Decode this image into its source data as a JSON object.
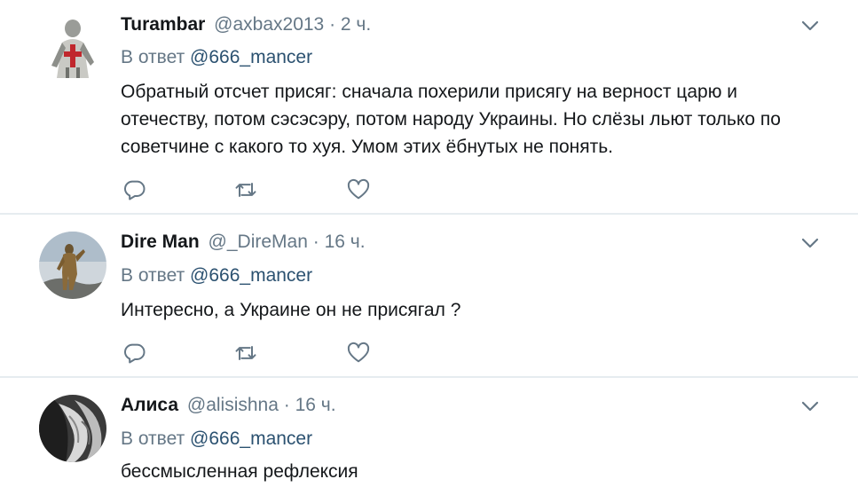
{
  "tweets": [
    {
      "name": "Turambar",
      "handle": "@axbax2013",
      "separator": "·",
      "time": "2 ч.",
      "reply_prefix": "В ответ",
      "reply_to": "@666_mancer",
      "text": "Обратный отсчет присяг: сначала похерили присягу на верност царю и отечеству, потом сэсэсэру, потом народу Украины. Но слёзы льют только по советчине с какого то хуя. Умом этих ёбнутых не понять."
    },
    {
      "name": "Dire Man",
      "handle": "@_DireMan",
      "separator": "·",
      "time": "16 ч.",
      "reply_prefix": "В ответ",
      "reply_to": "@666_mancer",
      "text": "Интересно, а Украине он не присягал ?"
    },
    {
      "name": "Алиса",
      "handle": "@alisishna",
      "separator": "·",
      "time": "16 ч.",
      "reply_prefix": "В ответ",
      "reply_to": "@666_mancer",
      "text": "бессмысленная рефлексия"
    }
  ],
  "icons": {
    "reply": "reply-icon",
    "retweet": "retweet-icon",
    "like": "heart-icon",
    "menu": "chevron-down-icon"
  },
  "colors": {
    "icon_gray": "#657786",
    "divider": "#e6ecf0",
    "text": "#14171a"
  }
}
